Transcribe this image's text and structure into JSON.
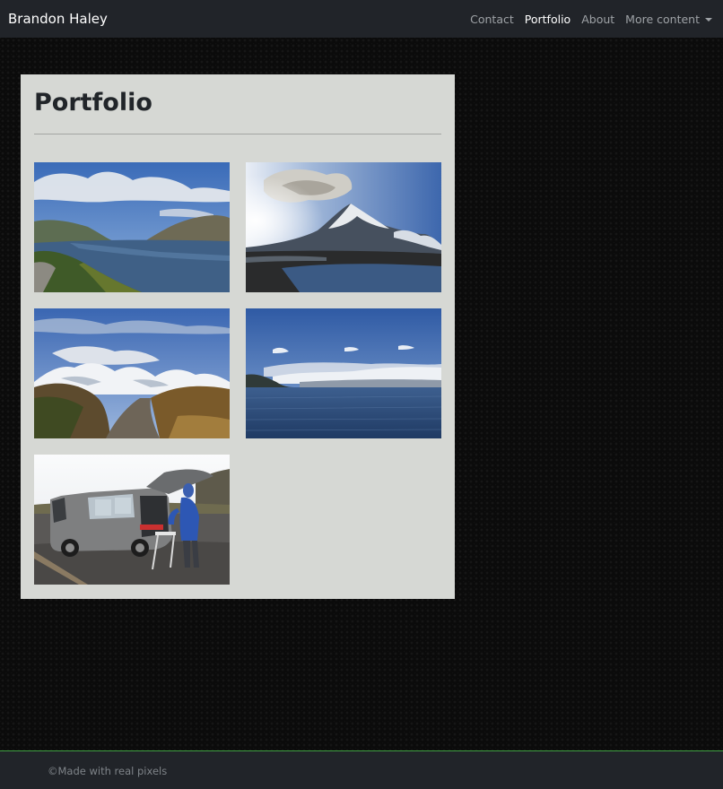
{
  "navbar": {
    "brand": "Brandon Haley",
    "links": [
      {
        "label": "Contact",
        "active": false
      },
      {
        "label": "Portfolio",
        "active": true
      },
      {
        "label": "About",
        "active": false
      },
      {
        "label": "More content",
        "active": false,
        "dropdown": true
      }
    ]
  },
  "main": {
    "title": "Portfolio",
    "photos": [
      {
        "subject": "fjord-road"
      },
      {
        "subject": "pyramid-mountain"
      },
      {
        "subject": "snowy-mountain-road"
      },
      {
        "subject": "lake-snowy-range"
      },
      {
        "subject": "camper-van"
      }
    ]
  },
  "footer": {
    "text": "©Made with real pixels"
  },
  "colors": {
    "navbar": "#212429",
    "panel": "#d6d8d4",
    "page_background": "#0b0b0b",
    "footer_accent": "#3fa142"
  }
}
